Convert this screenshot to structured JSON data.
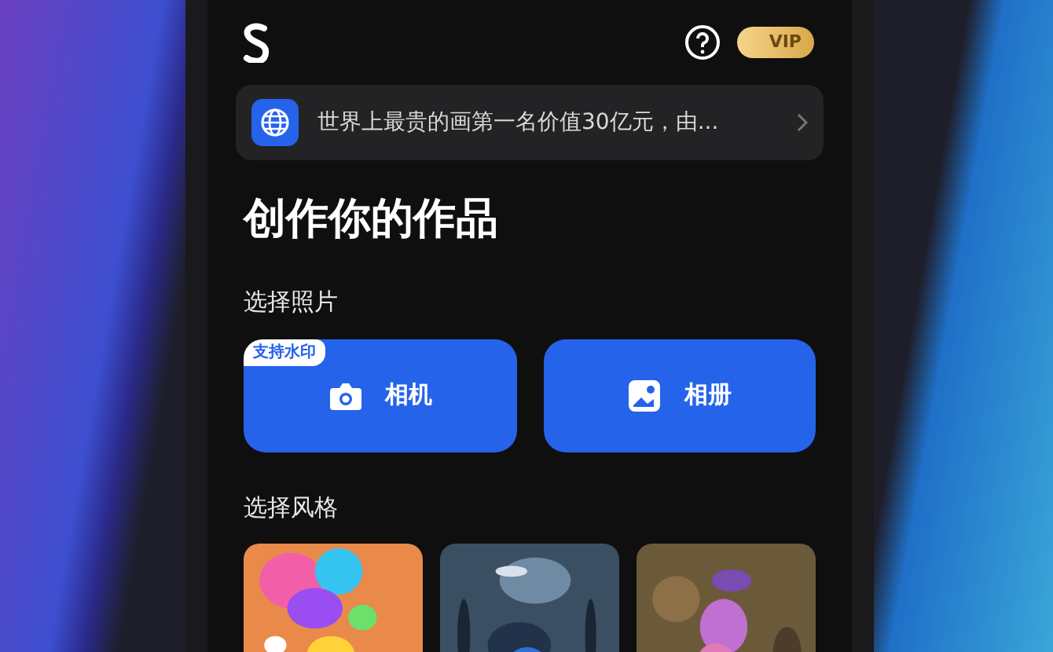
{
  "header": {
    "vip_badge": "VIP"
  },
  "notice": {
    "text": "世界上最贵的画第一名价值30亿元，由..."
  },
  "title": "创作你的作品",
  "photo_section": {
    "heading": "选择照片",
    "buttons": [
      {
        "kind": "camera",
        "label": "相机",
        "badge": "支持水印"
      },
      {
        "kind": "album",
        "label": "相册"
      }
    ]
  },
  "style_section": {
    "heading": "选择风格"
  }
}
